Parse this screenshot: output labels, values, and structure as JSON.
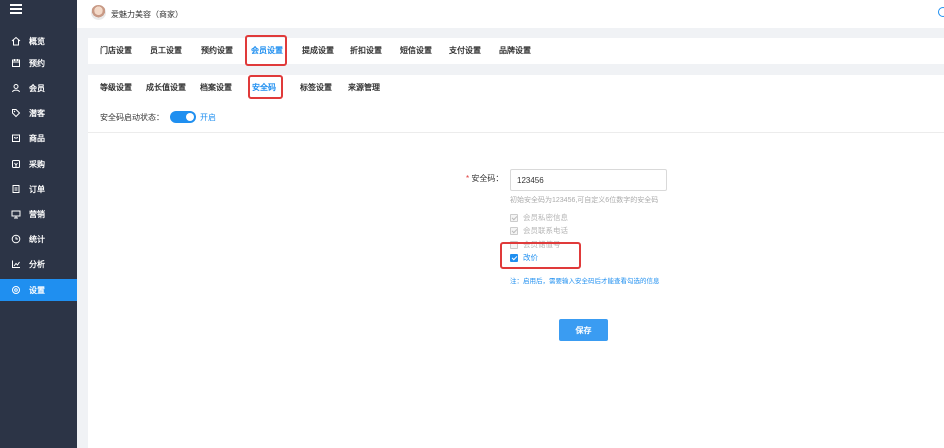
{
  "header": {
    "shop_name": "爱魅力美容（商家）"
  },
  "sidebar": {
    "items": [
      {
        "label": "概览",
        "icon": "home-icon"
      },
      {
        "label": "预约",
        "icon": "calendar-icon"
      },
      {
        "label": "会员",
        "icon": "user-icon"
      },
      {
        "label": "潜客",
        "icon": "tag-icon"
      },
      {
        "label": "商品",
        "icon": "box-icon"
      },
      {
        "label": "采购",
        "icon": "purchase-icon"
      },
      {
        "label": "订单",
        "icon": "order-icon"
      },
      {
        "label": "营销",
        "icon": "marketing-icon"
      },
      {
        "label": "统计",
        "icon": "clock-icon"
      },
      {
        "label": "分析",
        "icon": "chart-icon"
      },
      {
        "label": "设置",
        "icon": "gear-icon"
      }
    ],
    "active": "设置"
  },
  "tabs_primary": [
    {
      "label": "门店设置"
    },
    {
      "label": "员工设置"
    },
    {
      "label": "预约设置"
    },
    {
      "label": "会员设置"
    },
    {
      "label": "提成设置"
    },
    {
      "label": "折扣设置"
    },
    {
      "label": "短信设置"
    },
    {
      "label": "支付设置"
    },
    {
      "label": "品牌设置"
    }
  ],
  "tabs_secondary": [
    {
      "label": "等级设置"
    },
    {
      "label": "成长值设置"
    },
    {
      "label": "档案设置"
    },
    {
      "label": "安全码"
    },
    {
      "label": "标签设置"
    },
    {
      "label": "来源管理"
    }
  ],
  "status": {
    "label": "安全码启动状态：",
    "value": "开启",
    "enabled": true
  },
  "form": {
    "required_mark": "*",
    "label": "安全码：",
    "value": "123456",
    "hint": "初始安全码为123456,可自定义6位数字的安全码",
    "options": [
      {
        "label": "会员私密信息",
        "checked": true,
        "disabled": true
      },
      {
        "label": "会员联系电话",
        "checked": true,
        "disabled": true
      },
      {
        "label": "会员储值号",
        "checked": false,
        "disabled": true
      },
      {
        "label": "改价",
        "checked": true,
        "disabled": false
      }
    ],
    "note": "注：启用后，需要输入安全码后才能查看勾选的信息",
    "save_label": "保存"
  },
  "colors": {
    "accent": "#1f8ff0",
    "sidebar_bg": "#2c3446",
    "highlight": "#e03a3a"
  }
}
